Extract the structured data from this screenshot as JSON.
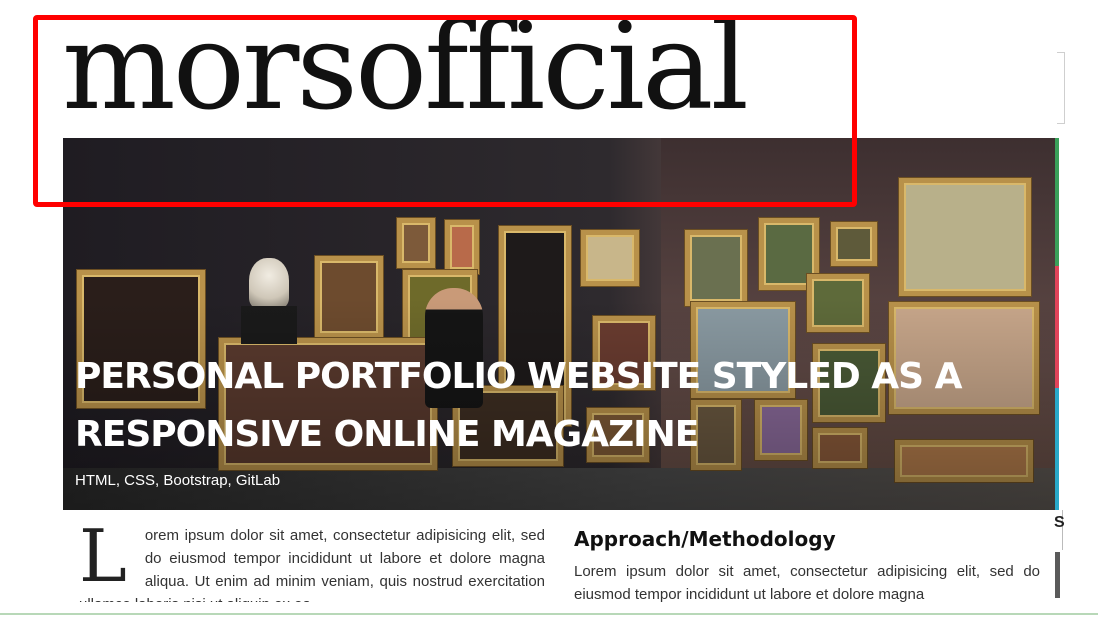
{
  "site": {
    "logo_text": "morsofficial"
  },
  "hero": {
    "title": "PERSONAL PORTFOLIO WEBSITE STYLED AS A RESPONSIVE ONLINE MAGAZINE",
    "tags": "HTML, CSS, Bootstrap, GitLab"
  },
  "article": {
    "dropcap": "L",
    "intro": "orem ipsum dolor sit amet, consectetur adipisicing elit, sed do eiusmod tempor incididunt ut labore et dolore magna aliqua. Ut enim ad minim veniam, quis nostrud exercitation ullamco laboris nisi ut aliquip ex ea"
  },
  "approach": {
    "heading": "Approach/Methodology",
    "text": "Lorem ipsum dolor sit amet, consectetur adipisicing elit, sed do eiusmod tempor incididunt ut labore et dolore magna"
  },
  "sidebar": {
    "partial_char": "S"
  },
  "colors": {
    "annotation_box": "#ff0000",
    "strip_green": "#3aa05a",
    "strip_red": "#e0445a",
    "strip_blue": "#29a9c9"
  }
}
